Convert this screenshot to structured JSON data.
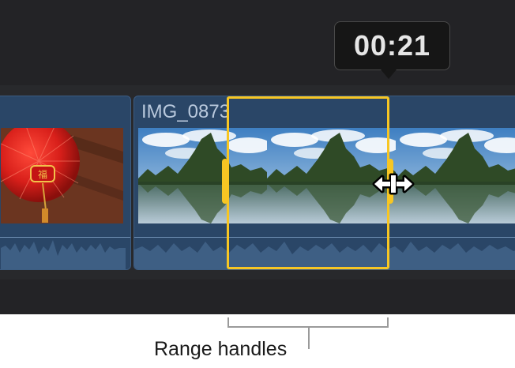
{
  "tooltip": {
    "timecode": "00:21"
  },
  "clips": [
    {
      "id": "clip-left",
      "title": ""
    },
    {
      "id": "clip-main",
      "title": "IMG_0873"
    }
  ],
  "range": {
    "caption": "Range handles"
  },
  "colors": {
    "range": "#f7c623",
    "clip": "#2a4667",
    "timeline": "#232326"
  },
  "icons": [
    "resize-cursor-icon",
    "range-handle"
  ]
}
